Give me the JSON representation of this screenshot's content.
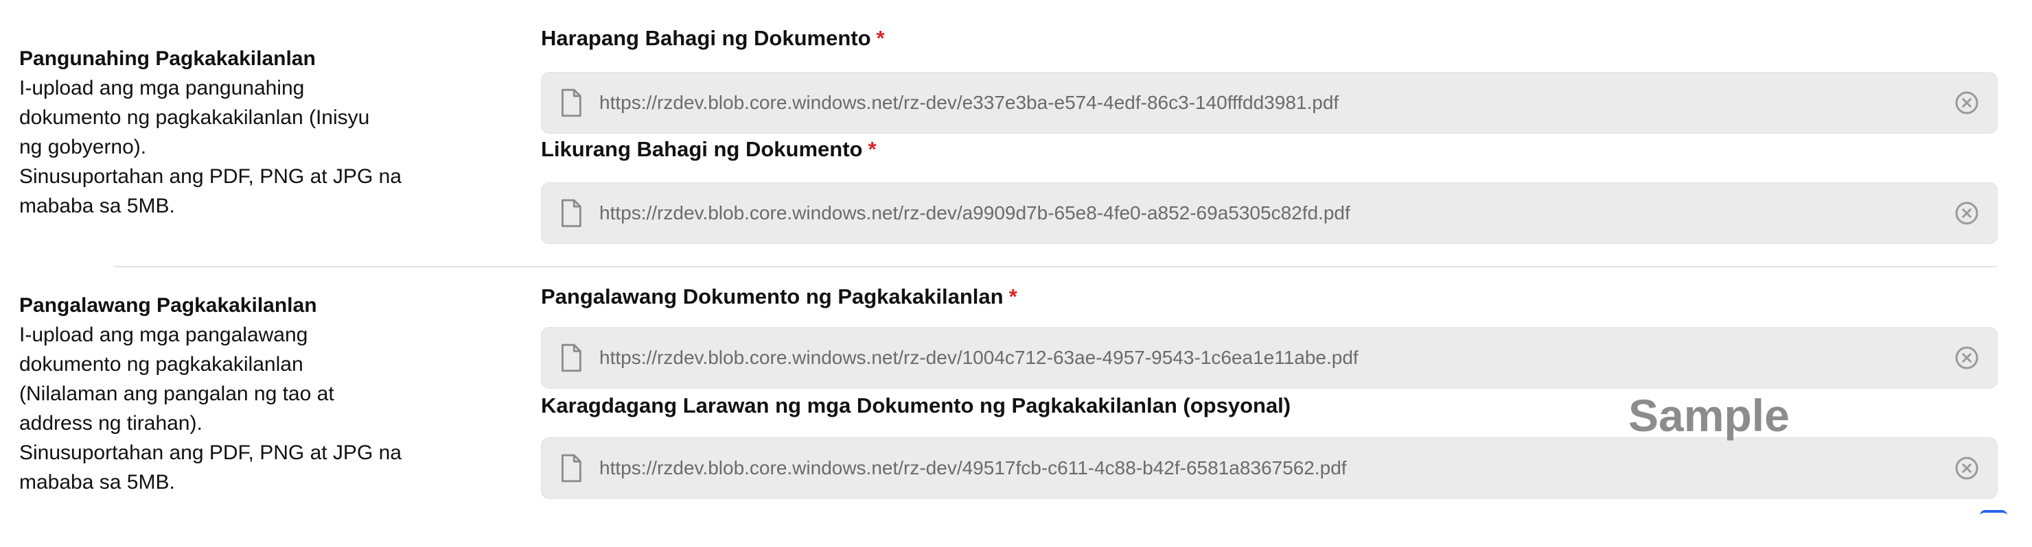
{
  "primary_id": {
    "title": "Pangunahing Pagkakakilanlan",
    "description_lines": [
      "I-upload ang mga pangunahing",
      "dokumento ng pagkakakilanlan (Inisyu",
      "ng gobyerno).",
      "Sinusuportahan ang PDF, PNG at JPG na",
      "mababa sa 5MB."
    ],
    "fields": [
      {
        "label": "Harapang Bahagi ng Dokumento",
        "required_mark": "*",
        "file_url": "https://rzdev.blob.core.windows.net/rz-dev/e337e3ba-e574-4edf-86c3-140fffdd3981.pdf"
      },
      {
        "label": "Likurang Bahagi ng Dokumento",
        "required_mark": "*",
        "file_url": "https://rzdev.blob.core.windows.net/rz-dev/a9909d7b-65e8-4fe0-a852-69a5305c82fd.pdf"
      }
    ]
  },
  "secondary_id": {
    "title": "Pangalawang Pagkakakilanlan",
    "description_lines": [
      "I-upload ang mga pangalawang",
      "dokumento ng pagkakakilanlan",
      "(Nilalaman ang pangalan ng tao at",
      "address ng tirahan).",
      "Sinusuportahan ang PDF, PNG at JPG na",
      "mababa sa 5MB."
    ],
    "fields": [
      {
        "label": "Pangalawang Dokumento ng Pagkakakilanlan",
        "required_mark": "*",
        "file_url": "https://rzdev.blob.core.windows.net/rz-dev/1004c712-63ae-4957-9543-1c6ea1e11abe.pdf"
      },
      {
        "label": "Karagdagang Larawan ng mga Dokumento ng Pagkakakilanlan (opsyonal)",
        "file_url": "https://rzdev.blob.core.windows.net/rz-dev/49517fcb-c611-4c88-b42f-6581a8367562.pdf"
      }
    ]
  },
  "watermark": "Sample",
  "icons": {
    "file": "file-icon",
    "clear": "close-circle-icon"
  },
  "colors": {
    "required": "#e02424",
    "field_bg": "#ebebeb",
    "url_text": "#6b6b6b",
    "accent": "#2563eb"
  }
}
